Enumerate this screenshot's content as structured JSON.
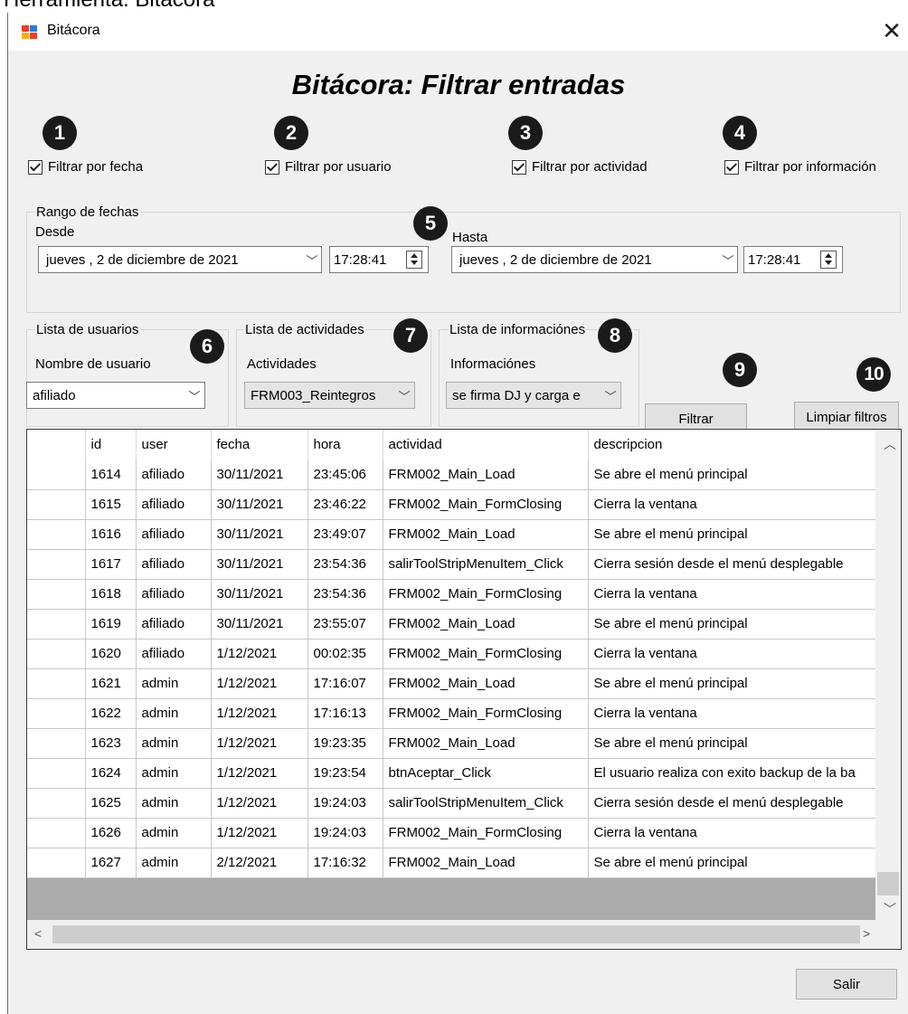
{
  "document_heading": "Herramienta: Bitácora",
  "window": {
    "title": "Bitácora",
    "close_glyph": "✕",
    "heading": "Bitácora: Filtrar entradas"
  },
  "badges": [
    "1",
    "2",
    "3",
    "4",
    "5",
    "6",
    "7",
    "8",
    "9",
    "10"
  ],
  "filters": {
    "fecha": "Filtrar por fecha",
    "usuario": "Filtrar por usuario",
    "actividad": "Filtrar por actividad",
    "informacion": "Filtrar por información"
  },
  "date_range": {
    "group_label": "Rango de fechas",
    "desde_label": "Desde",
    "hasta_label": "Hasta",
    "desde_date": "jueves   ,   2 de  diciembre  de 2021",
    "desde_time": "17:28:41",
    "hasta_date": "jueves   ,   2 de  diciembre  de 2021",
    "hasta_time": "17:28:41"
  },
  "users": {
    "group_label": "Lista de usuarios",
    "field_label": "Nombre de usuario",
    "selected": "afiliado"
  },
  "activities": {
    "group_label": "Lista de actividades",
    "field_label": "Actividades",
    "selected": "FRM003_Reintegros"
  },
  "infos": {
    "group_label": "Lista de informaciónes",
    "field_label": "Informaciónes",
    "selected": "se firma DJ y carga e"
  },
  "buttons": {
    "filtrar": "Filtrar",
    "limpiar": "Limpiar filtros",
    "salir": "Salir"
  },
  "grid": {
    "columns": [
      "id",
      "user",
      "fecha",
      "hora",
      "actividad",
      "descripcion"
    ],
    "rows": [
      [
        "1614",
        "afiliado",
        "30/11/2021",
        "23:45:06",
        "FRM002_Main_Load",
        "Se abre el menú principal"
      ],
      [
        "1615",
        "afiliado",
        "30/11/2021",
        "23:46:22",
        "FRM002_Main_FormClosing",
        "Cierra la ventana"
      ],
      [
        "1616",
        "afiliado",
        "30/11/2021",
        "23:49:07",
        "FRM002_Main_Load",
        "Se abre el menú principal"
      ],
      [
        "1617",
        "afiliado",
        "30/11/2021",
        "23:54:36",
        "salirToolStripMenuItem_Click",
        "Cierra sesión desde el menú desplegable"
      ],
      [
        "1618",
        "afiliado",
        "30/11/2021",
        "23:54:36",
        "FRM002_Main_FormClosing",
        "Cierra la ventana"
      ],
      [
        "1619",
        "afiliado",
        "30/11/2021",
        "23:55:07",
        "FRM002_Main_Load",
        "Se abre el menú principal"
      ],
      [
        "1620",
        "afiliado",
        "1/12/2021",
        "00:02:35",
        "FRM002_Main_FormClosing",
        "Cierra la ventana"
      ],
      [
        "1621",
        "admin",
        "1/12/2021",
        "17:16:07",
        "FRM002_Main_Load",
        "Se abre el menú principal"
      ],
      [
        "1622",
        "admin",
        "1/12/2021",
        "17:16:13",
        "FRM002_Main_FormClosing",
        "Cierra la ventana"
      ],
      [
        "1623",
        "admin",
        "1/12/2021",
        "19:23:35",
        "FRM002_Main_Load",
        "Se abre el menú principal"
      ],
      [
        "1624",
        "admin",
        "1/12/2021",
        "19:23:54",
        "btnAceptar_Click",
        "El usuario realiza con exito backup de la ba"
      ],
      [
        "1625",
        "admin",
        "1/12/2021",
        "19:24:03",
        "salirToolStripMenuItem_Click",
        "Cierra sesión desde el menú desplegable"
      ],
      [
        "1626",
        "admin",
        "1/12/2021",
        "19:24:03",
        "FRM002_Main_FormClosing",
        "Cierra la ventana"
      ],
      [
        "1627",
        "admin",
        "2/12/2021",
        "17:16:32",
        "FRM002_Main_Load",
        "Se abre el menú principal"
      ]
    ]
  }
}
